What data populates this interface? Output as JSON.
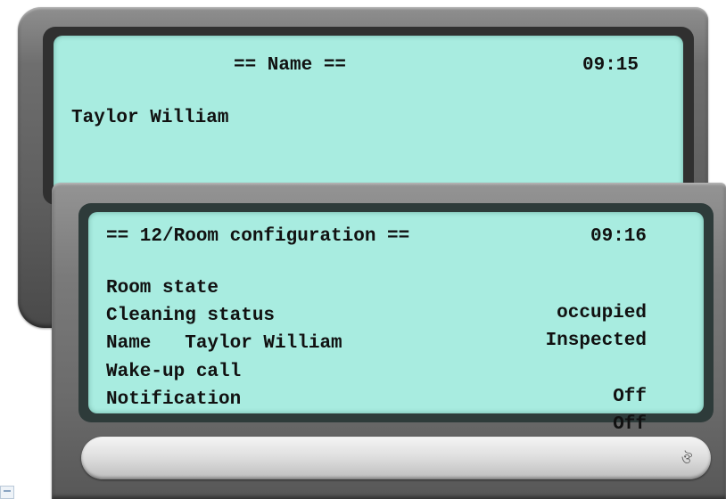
{
  "screen_top": {
    "title": "== Name ==",
    "time": "09:15",
    "name_value": "Taylor William"
  },
  "screen_bottom": {
    "title": "== 12/Room configuration ==",
    "time": "09:16",
    "rows": [
      {
        "label": "Room state",
        "value": "occupied"
      },
      {
        "label": "Cleaning status",
        "value": "Inspected"
      },
      {
        "label": "Name   Taylor William",
        "value": ""
      },
      {
        "label": "Wake-up call",
        "value": "Off"
      },
      {
        "label": "Notification",
        "value": "Off"
      }
    ]
  },
  "icons": {
    "brand_logo": "brand-logo-icon",
    "corner_thumbnail": "window-thumbnail-icon"
  },
  "colors": {
    "lcd_background": "#a8ece0",
    "lcd_text": "#111111",
    "bezel": "#6e6e6e"
  }
}
